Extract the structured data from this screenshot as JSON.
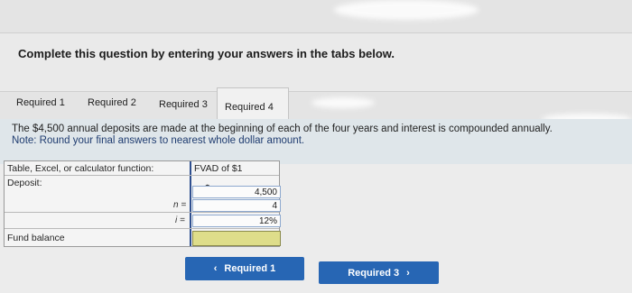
{
  "instruction": "Complete this question by entering your answers in the tabs below.",
  "tabs": [
    {
      "label": "Required 1"
    },
    {
      "label": "Required 2"
    },
    {
      "label": "Required 3"
    },
    {
      "label": "Required 4"
    }
  ],
  "question": {
    "text": "The $4,500 annual deposits are made at the beginning of each of the four years and interest is compounded annually.",
    "note": "Note: Round your final answers to nearest whole dollar amount."
  },
  "table": {
    "header_label": "Table, Excel, or calculator function:",
    "header_value": "FVAD of $1",
    "deposit_label": "Deposit:",
    "deposit_symbol": "$",
    "deposit_value": "4,500",
    "n_label": "n =",
    "n_value": "4",
    "i_label": "i =",
    "i_value": "12%",
    "fund_label": "Fund balance",
    "fund_value": ""
  },
  "nav": {
    "prev_label": "Required 1",
    "next_label": "Required 3",
    "prev_icon": "chevron-left-icon",
    "next_icon": "chevron-right-icon",
    "button_color": "#2766b4",
    "answer_highlight": "#dedd8a"
  }
}
